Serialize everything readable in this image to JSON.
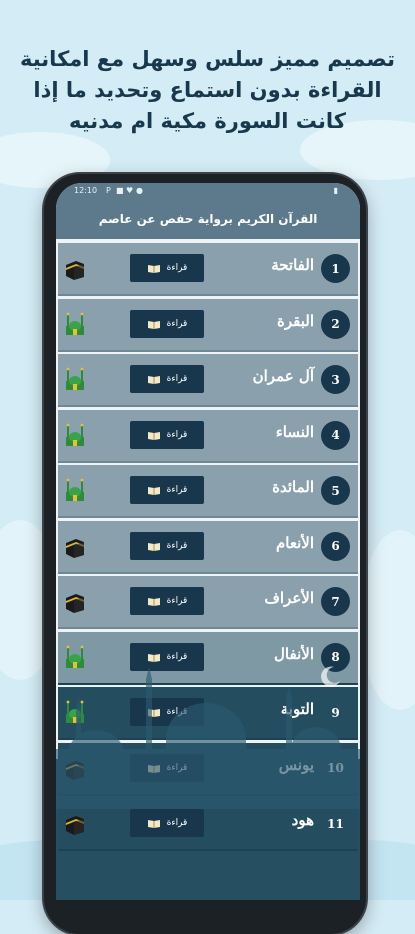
{
  "headline": {
    "line1": "تصميم مميز سلس وسهل مع امكانية",
    "line2": "القراءة بدون استماع وتحديد ما إذا",
    "line3": "كانت السورة مكية ام مدنيه"
  },
  "status_bar": {
    "time": "12:10",
    "icons": [
      "P",
      "■",
      "♥",
      "●"
    ]
  },
  "app_bar": {
    "title": "القرآن الكريم برواية حفص عن عاصم"
  },
  "read_label": "قراءة",
  "surahs": [
    {
      "number": "1",
      "name": "الفاتحة",
      "type": "kaaba"
    },
    {
      "number": "2",
      "name": "البقرة",
      "type": "mosque"
    },
    {
      "number": "3",
      "name": "آل عمران",
      "type": "mosque"
    },
    {
      "number": "4",
      "name": "النساء",
      "type": "mosque"
    },
    {
      "number": "5",
      "name": "المائدة",
      "type": "mosque"
    },
    {
      "number": "6",
      "name": "الأنعام",
      "type": "kaaba"
    },
    {
      "number": "7",
      "name": "الأعراف",
      "type": "kaaba"
    },
    {
      "number": "8",
      "name": "الأنفال",
      "type": "mosque"
    },
    {
      "number": "9",
      "name": "التوبة",
      "type": "mosque"
    },
    {
      "number": "10",
      "name": "يونس",
      "type": "kaaba"
    },
    {
      "number": "11",
      "name": "هود",
      "type": "kaaba"
    }
  ],
  "colors": {
    "background": "#d4ecf5",
    "header": "#5c7a8c",
    "row": "#8aa0ad",
    "accent": "#18374c",
    "headline_text": "#17384d"
  }
}
